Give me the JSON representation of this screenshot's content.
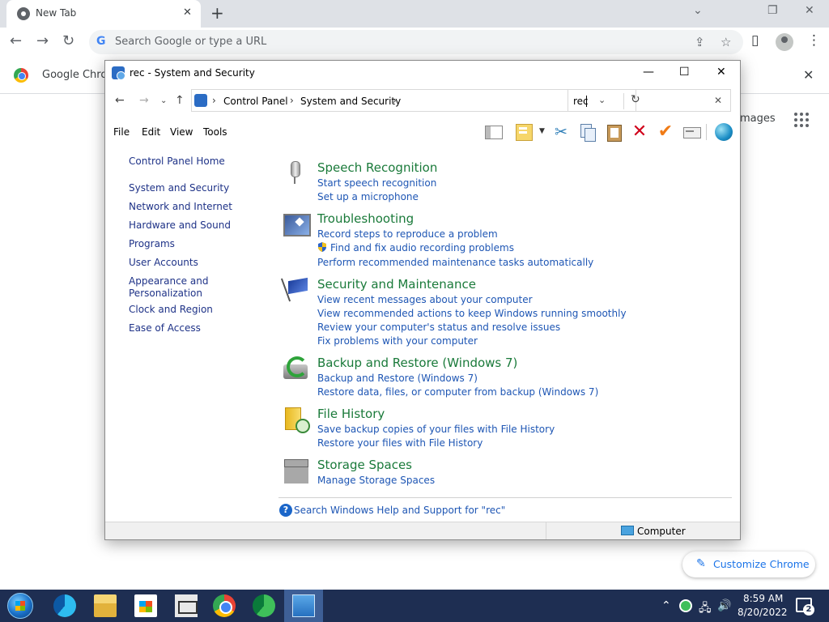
{
  "chrome": {
    "tab_title": "New Tab",
    "tab_close": "✕",
    "new_tab": "+",
    "omnibox_placeholder": "Search Google or type a URL",
    "bookmark_label": "Google Chrom",
    "images_link": "mages",
    "customize_label": "Customize Chrome",
    "window_controls": {
      "minimize": "⌄",
      "restore": "❐",
      "close": "✕"
    }
  },
  "control_panel": {
    "window_title": "rec - System and Security",
    "breadcrumb": [
      "Control Panel",
      "System and Security"
    ],
    "search_value": "rec",
    "menu": [
      "File",
      "Edit",
      "View",
      "Tools"
    ],
    "sidebar": [
      "Control Panel Home",
      "System and Security",
      "Network and Internet",
      "Hardware and Sound",
      "Programs",
      "User Accounts",
      "Appearance and Personalization",
      "Clock and Region",
      "Ease of Access"
    ],
    "categories": [
      {
        "title": "Speech Recognition",
        "icon": "microphone-icon",
        "links": [
          "Start speech recognition",
          "Set up a microphone"
        ]
      },
      {
        "title": "Troubleshooting",
        "icon": "troubleshooting-icon",
        "links": [
          "Record steps to reproduce a problem",
          "Find and fix audio recording problems",
          "Perform recommended maintenance tasks automatically"
        ]
      },
      {
        "title": "Security and Maintenance",
        "icon": "flag-icon",
        "links": [
          "View recent messages about your computer",
          "View recommended actions to keep Windows running smoothly",
          "Review your computer's status and resolve issues",
          "Fix problems with your computer"
        ]
      },
      {
        "title": "Backup and Restore (Windows 7)",
        "icon": "backup-icon",
        "links": [
          "Backup and Restore (Windows 7)",
          "Restore data, files, or computer from backup (Windows 7)"
        ]
      },
      {
        "title": "File History",
        "icon": "file-history-icon",
        "links": [
          "Save backup copies of your files with File History",
          "Restore your files with File History"
        ]
      },
      {
        "title": "Storage Spaces",
        "icon": "storage-spaces-icon",
        "links": [
          "Manage Storage Spaces"
        ]
      }
    ],
    "help_link": "Search Windows Help and Support for \"rec\"",
    "status_text": "Computer"
  },
  "taskbar": {
    "clock_time": "8:59 AM",
    "clock_date": "8/20/2022",
    "notification_count": "2"
  }
}
